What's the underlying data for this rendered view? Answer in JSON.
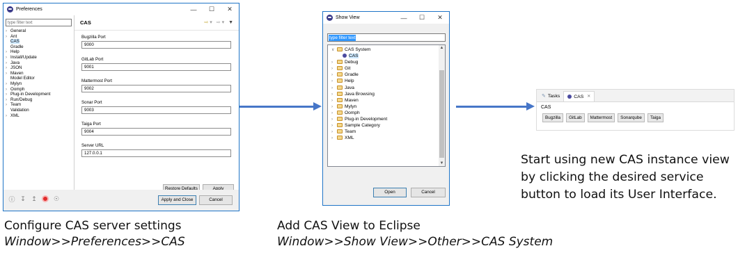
{
  "preferences": {
    "title": "Preferences",
    "filter_placeholder": "type filter text",
    "tree": [
      {
        "label": "General",
        "arrow": true
      },
      {
        "label": "Ant",
        "arrow": true
      },
      {
        "label": "CAS",
        "arrow": false,
        "selected": true
      },
      {
        "label": "Gradle",
        "arrow": false
      },
      {
        "label": "Help",
        "arrow": true
      },
      {
        "label": "Install/Update",
        "arrow": true
      },
      {
        "label": "Java",
        "arrow": true
      },
      {
        "label": "JSON",
        "arrow": true
      },
      {
        "label": "Maven",
        "arrow": true
      },
      {
        "label": "Model Editor",
        "arrow": false
      },
      {
        "label": "Mylyn",
        "arrow": true
      },
      {
        "label": "Oomph",
        "arrow": true
      },
      {
        "label": "Plug-in Development",
        "arrow": true
      },
      {
        "label": "Run/Debug",
        "arrow": true
      },
      {
        "label": "Team",
        "arrow": true
      },
      {
        "label": "Validation",
        "arrow": false
      },
      {
        "label": "XML",
        "arrow": true
      }
    ],
    "page_title": "CAS",
    "fields": {
      "bugzilla": {
        "label": "Bugzilla Port",
        "value": "9000"
      },
      "gitlab": {
        "label": "GitLab Port",
        "value": "9001"
      },
      "mattermost": {
        "label": "Mattermost Port",
        "value": "9002"
      },
      "sonar": {
        "label": "Sonar Port",
        "value": "9003"
      },
      "taiga": {
        "label": "Taiga Port",
        "value": "9004"
      },
      "server": {
        "label": "Server URL",
        "value": "127.0.0.1"
      }
    },
    "restore_defaults": "Restore Defaults",
    "apply": "Apply",
    "apply_and_close": "Apply and Close",
    "cancel": "Cancel"
  },
  "show_view": {
    "title": "Show View",
    "filter_text": "type filter text",
    "items": [
      {
        "label": "CAS System",
        "type": "folder",
        "expanded": true
      },
      {
        "label": "CAS",
        "type": "view",
        "selected": true
      },
      {
        "label": "Debug",
        "type": "folder"
      },
      {
        "label": "Git",
        "type": "folder"
      },
      {
        "label": "Gradle",
        "type": "folder"
      },
      {
        "label": "Help",
        "type": "folder"
      },
      {
        "label": "Java",
        "type": "folder"
      },
      {
        "label": "Java Browsing",
        "type": "folder"
      },
      {
        "label": "Maven",
        "type": "folder"
      },
      {
        "label": "Mylyn",
        "type": "folder"
      },
      {
        "label": "Oomph",
        "type": "folder"
      },
      {
        "label": "Plug-in Development",
        "type": "folder"
      },
      {
        "label": "Sample Category",
        "type": "folder"
      },
      {
        "label": "Team",
        "type": "folder"
      },
      {
        "label": "XML",
        "type": "folder"
      }
    ],
    "open": "Open",
    "cancel": "Cancel"
  },
  "cas_view": {
    "tabs": [
      {
        "label": "Tasks",
        "icon": "tasks-icon"
      },
      {
        "label": "CAS",
        "icon": "cas-icon",
        "active": true
      }
    ],
    "label": "CAS",
    "buttons": [
      "Bugzilla",
      "GitLab",
      "Mattermost",
      "Sonarqube",
      "Taiga"
    ]
  },
  "captions": {
    "configure_line1": "Configure CAS server settings",
    "configure_line2": "Window>>Preferences>>CAS",
    "add_line1": "Add CAS View to Eclipse",
    "add_line2": "Window>>Show View>>Other>>CAS System",
    "start_text": "Start using new CAS instance view by clicking the desired service button to load its User Interface."
  },
  "colors": {
    "arrow": "#4676c8",
    "window_border": "#1e74c7",
    "selection": "#cce8ff"
  }
}
